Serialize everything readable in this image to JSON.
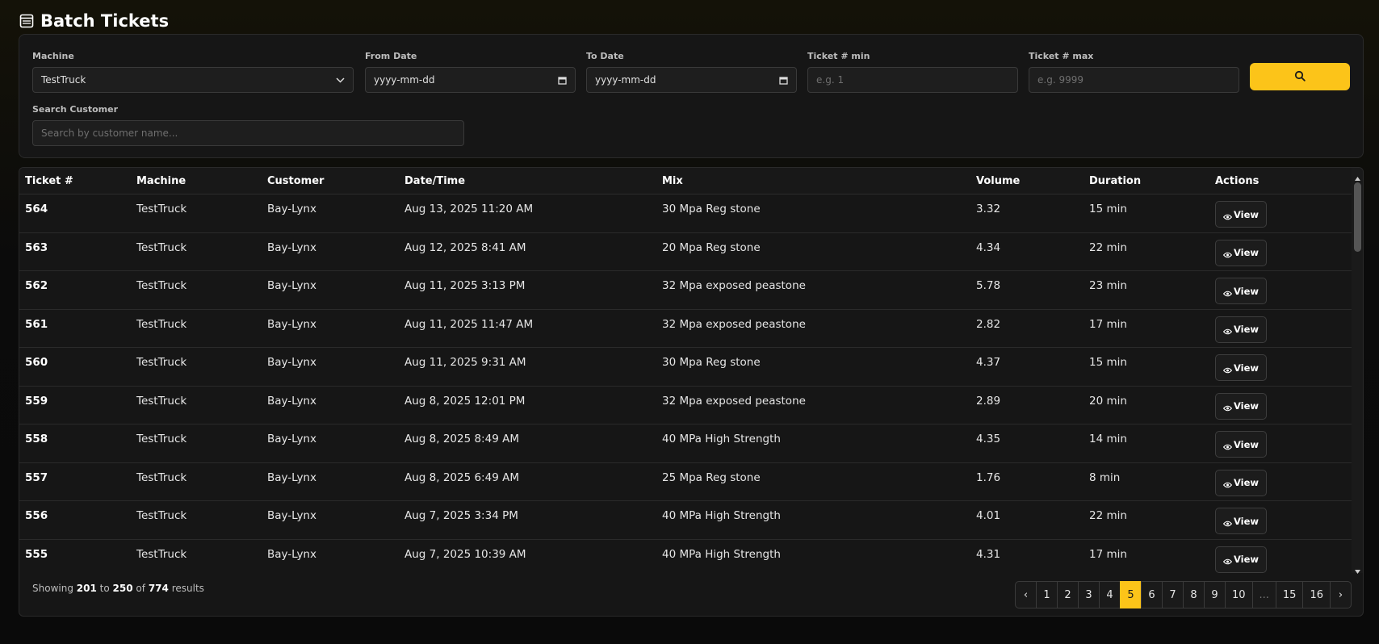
{
  "header": {
    "title": "Batch Tickets",
    "icon": "list-table-icon"
  },
  "filters": {
    "machine": {
      "label": "Machine",
      "value": "TestTruck"
    },
    "from_date": {
      "label": "From Date",
      "placeholder": "yyyy-mm-dd"
    },
    "to_date": {
      "label": "To Date",
      "placeholder": "yyyy-mm-dd"
    },
    "ticket_min": {
      "label": "Ticket # min",
      "placeholder": "e.g. 1"
    },
    "ticket_max": {
      "label": "Ticket # max",
      "placeholder": "e.g. 9999"
    },
    "customer": {
      "label": "Search Customer",
      "placeholder": "Search by customer name..."
    },
    "search_button_icon": "search-icon"
  },
  "table": {
    "columns": [
      "Ticket #",
      "Machine",
      "Customer",
      "Date/Time",
      "Mix",
      "Volume",
      "Duration",
      "Actions"
    ],
    "view_label": "View",
    "rows": [
      {
        "ticket": "564",
        "machine": "TestTruck",
        "customer": "Bay-Lynx",
        "datetime": "Aug 13, 2025 11:20 AM",
        "mix": "30 Mpa Reg stone",
        "volume": "3.32",
        "duration": "15 min"
      },
      {
        "ticket": "563",
        "machine": "TestTruck",
        "customer": "Bay-Lynx",
        "datetime": "Aug 12, 2025 8:41 AM",
        "mix": "20 Mpa Reg stone",
        "volume": "4.34",
        "duration": "22 min"
      },
      {
        "ticket": "562",
        "machine": "TestTruck",
        "customer": "Bay-Lynx",
        "datetime": "Aug 11, 2025 3:13 PM",
        "mix": "32 Mpa exposed peastone",
        "volume": "5.78",
        "duration": "23 min"
      },
      {
        "ticket": "561",
        "machine": "TestTruck",
        "customer": "Bay-Lynx",
        "datetime": "Aug 11, 2025 11:47 AM",
        "mix": "32 Mpa exposed peastone",
        "volume": "2.82",
        "duration": "17 min"
      },
      {
        "ticket": "560",
        "machine": "TestTruck",
        "customer": "Bay-Lynx",
        "datetime": "Aug 11, 2025 9:31 AM",
        "mix": "30 Mpa Reg stone",
        "volume": "4.37",
        "duration": "15 min"
      },
      {
        "ticket": "559",
        "machine": "TestTruck",
        "customer": "Bay-Lynx",
        "datetime": "Aug 8, 2025 12:01 PM",
        "mix": "32 Mpa exposed peastone",
        "volume": "2.89",
        "duration": "20 min"
      },
      {
        "ticket": "558",
        "machine": "TestTruck",
        "customer": "Bay-Lynx",
        "datetime": "Aug 8, 2025 8:49 AM",
        "mix": "40 MPa High Strength",
        "volume": "4.35",
        "duration": "14 min"
      },
      {
        "ticket": "557",
        "machine": "TestTruck",
        "customer": "Bay-Lynx",
        "datetime": "Aug 8, 2025 6:49 AM",
        "mix": "25 Mpa Reg stone",
        "volume": "1.76",
        "duration": "8 min"
      },
      {
        "ticket": "556",
        "machine": "TestTruck",
        "customer": "Bay-Lynx",
        "datetime": "Aug 7, 2025 3:34 PM",
        "mix": "40 MPa High Strength",
        "volume": "4.01",
        "duration": "22 min"
      },
      {
        "ticket": "555",
        "machine": "TestTruck",
        "customer": "Bay-Lynx",
        "datetime": "Aug 7, 2025 10:39 AM",
        "mix": "40 MPa High Strength",
        "volume": "4.31",
        "duration": "17 min"
      }
    ]
  },
  "footer": {
    "showing": "Showing",
    "from": "201",
    "to_word": "to",
    "to": "250",
    "of_word": "of",
    "total": "774",
    "results_word": "results"
  },
  "pagination": {
    "prev": "‹",
    "next": "›",
    "pages": [
      "1",
      "2",
      "3",
      "4",
      "5",
      "6",
      "7",
      "8",
      "9",
      "10",
      "...",
      "15",
      "16"
    ],
    "current": "5"
  },
  "colors": {
    "accent": "#fcc419",
    "background": "#0b0b0b",
    "panel": "#161616"
  }
}
